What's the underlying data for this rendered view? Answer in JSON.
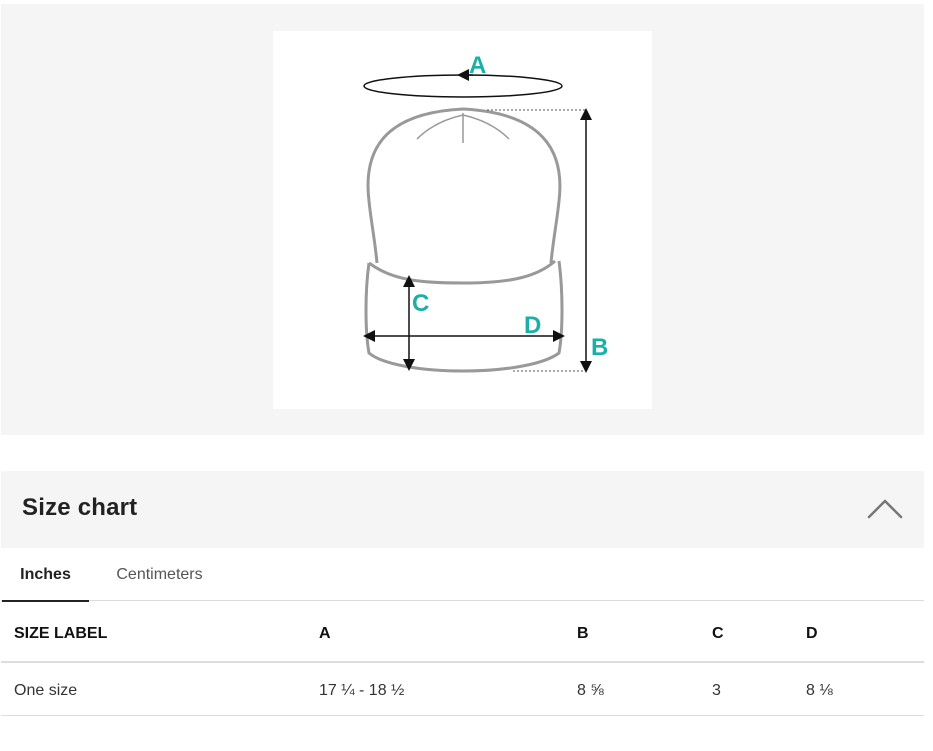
{
  "diagram": {
    "labels": {
      "a": "A",
      "b": "B",
      "c": "C",
      "d": "D"
    },
    "label_color": "#1ab0a8",
    "outline_color": "#999999"
  },
  "size_chart": {
    "title": "Size chart",
    "collapse_icon": "chevron-up-icon"
  },
  "tabs": [
    {
      "label": "Inches",
      "active": true
    },
    {
      "label": "Centimeters",
      "active": false
    }
  ],
  "table": {
    "headers": [
      "SIZE LABEL",
      "A",
      "B",
      "C",
      "D"
    ],
    "rows": [
      [
        "One size",
        "17 ¼ - 18 ½",
        "8 ⅝",
        "3",
        "8 ⅛"
      ]
    ]
  }
}
